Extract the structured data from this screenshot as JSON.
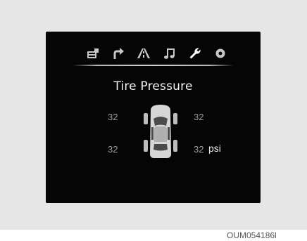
{
  "display": {
    "tabs": [
      {
        "icon": "trip-computer-icon",
        "active": false
      },
      {
        "icon": "turn-by-turn-icon",
        "active": false
      },
      {
        "icon": "road-lane-icon",
        "active": false
      },
      {
        "icon": "music-note-icon",
        "active": false
      },
      {
        "icon": "wrench-icon",
        "active": true
      },
      {
        "icon": "settings-gear-icon",
        "active": false
      }
    ],
    "title": "Tire Pressure",
    "tires": {
      "front_left": "32",
      "front_right": "32",
      "rear_left": "32",
      "rear_right": "32"
    },
    "unit": "psi"
  },
  "image_code": "OUM054186l",
  "colors": {
    "screen_bg": "#050505",
    "value_text": "#9a9a9a",
    "title_text": "#f2f2f2",
    "active_tab": "#ffffff",
    "inactive_tab": "#c8c8c8"
  }
}
